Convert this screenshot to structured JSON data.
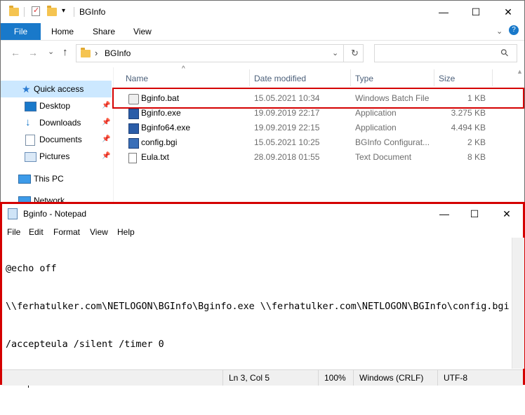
{
  "explorer": {
    "title": "BGInfo",
    "ribbon_tabs": [
      "File",
      "Home",
      "Share",
      "View"
    ],
    "address": {
      "path": "BGInfo",
      "separator": "›"
    },
    "nav": {
      "back_icon": "←",
      "forward_icon": "→",
      "dropdown_icon": "⌄",
      "up_icon": "↑",
      "refresh_icon": "↻",
      "search_icon": "⚲"
    },
    "nav_pane": [
      {
        "label": "Quick access",
        "icon": "star-icon",
        "selected": true,
        "pinned": false
      },
      {
        "label": "Desktop",
        "icon": "desktop-icon",
        "pinned": true
      },
      {
        "label": "Downloads",
        "icon": "download-icon",
        "pinned": true
      },
      {
        "label": "Documents",
        "icon": "documents-icon",
        "pinned": true
      },
      {
        "label": "Pictures",
        "icon": "pictures-icon",
        "pinned": true
      },
      {
        "label": "This PC",
        "icon": "computer-icon",
        "pinned": false
      },
      {
        "label": "Network",
        "icon": "network-icon",
        "pinned": false
      }
    ],
    "columns": [
      "Name",
      "Date modified",
      "Type",
      "Size"
    ],
    "files": [
      {
        "name": "Bginfo.bat",
        "date": "15.05.2021 10:34",
        "type": "Windows Batch File",
        "size": "1 KB",
        "icon": "batch-file-icon",
        "highlighted": true
      },
      {
        "name": "Bginfo.exe",
        "date": "19.09.2019 22:17",
        "type": "Application",
        "size": "3.275 KB",
        "icon": "application-icon"
      },
      {
        "name": "Bginfo64.exe",
        "date": "19.09.2019 22:15",
        "type": "Application",
        "size": "4.494 KB",
        "icon": "application-icon"
      },
      {
        "name": "config.bgi",
        "date": "15.05.2021 10:25",
        "type": "BGInfo Configurat...",
        "size": "2 KB",
        "icon": "config-file-icon"
      },
      {
        "name": "Eula.txt",
        "date": "28.09.2018 01:55",
        "type": "Text Document",
        "size": "8 KB",
        "icon": "text-file-icon"
      }
    ],
    "sort_indicator": "^",
    "caption": {
      "minimize": "—",
      "maximize": "☐",
      "close": "✕",
      "help": "?",
      "expand": "⌄"
    },
    "qat_dropdown": "▾"
  },
  "notepad": {
    "title": "Bginfo - Notepad",
    "menu": [
      "File",
      "Edit",
      "Format",
      "View",
      "Help"
    ],
    "lines": [
      "@echo off",
      "\\\\ferhatulker.com\\NETLOGON\\BGInfo\\Bginfo.exe \\\\ferhatulker.com\\NETLOGON\\BGInfo\\config.bgi",
      "/accepteula /silent /timer 0",
      "Exit"
    ],
    "status": {
      "position": "Ln 3, Col 5",
      "zoom": "100%",
      "line_endings": "Windows (CRLF)",
      "encoding": "UTF-8"
    },
    "caption": {
      "minimize": "—",
      "maximize": "☐",
      "close": "✕"
    }
  },
  "colors": {
    "accent": "#1979ca",
    "highlight": "#d40000",
    "selection": "#cce8ff"
  }
}
